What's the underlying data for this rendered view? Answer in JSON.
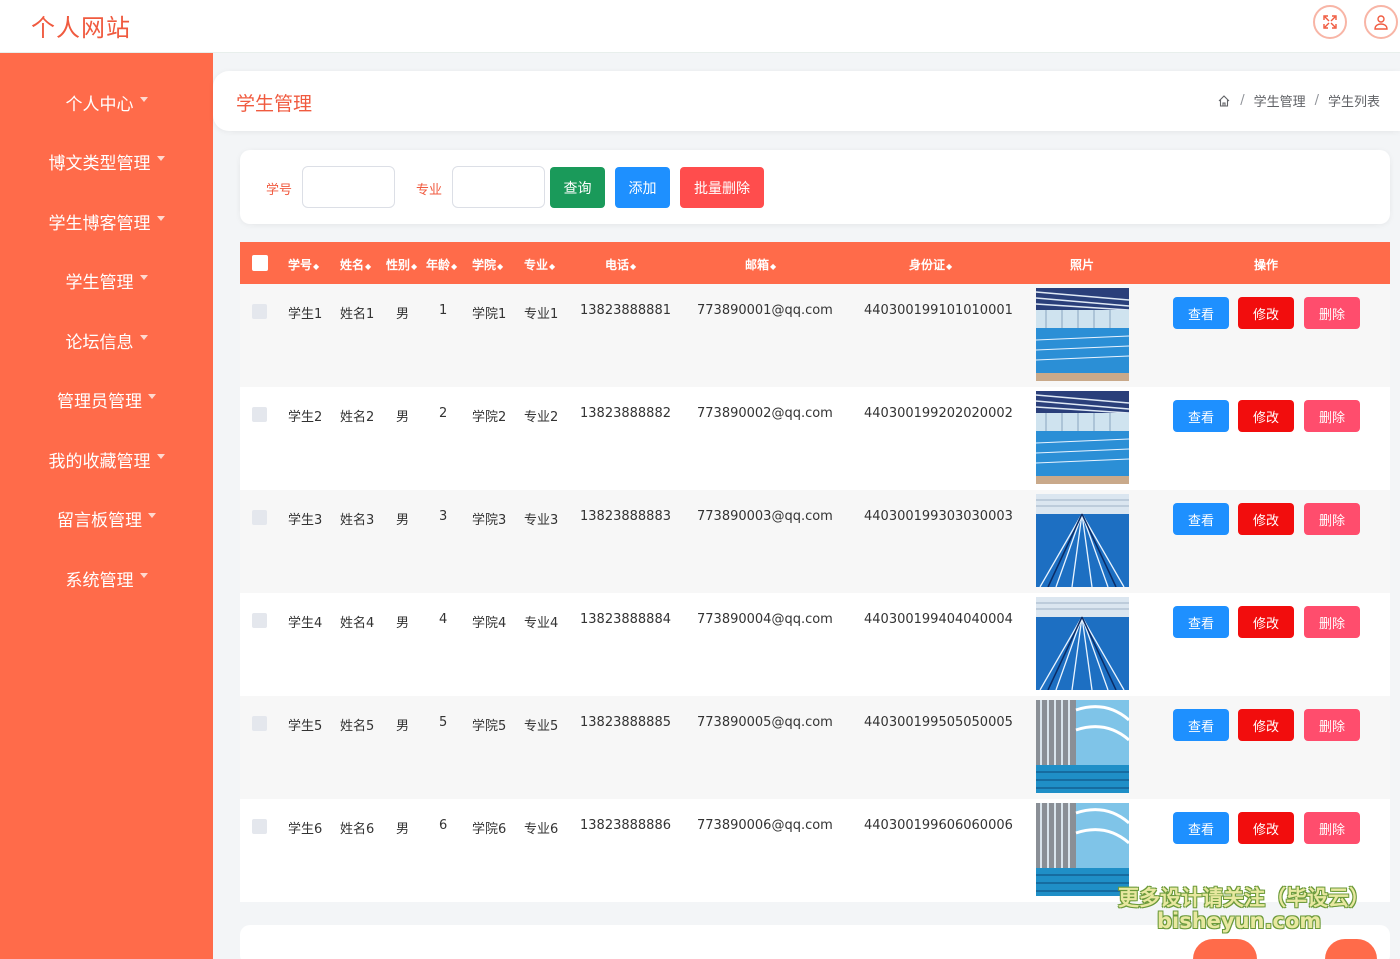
{
  "header": {
    "brand": "个人网站",
    "fullscreen_icon": "fullscreen-icon",
    "user_icon": "user-icon"
  },
  "sidebar": {
    "items": [
      {
        "label": "个人中心"
      },
      {
        "label": "博文类型管理"
      },
      {
        "label": "学生博客管理"
      },
      {
        "label": "学生管理"
      },
      {
        "label": "论坛信息"
      },
      {
        "label": "管理员管理"
      },
      {
        "label": "我的收藏管理"
      },
      {
        "label": "留言板管理"
      },
      {
        "label": "系统管理"
      }
    ]
  },
  "title_bar": {
    "title": "学生管理",
    "breadcrumb": [
      "学生管理",
      "学生列表"
    ],
    "sep": "/"
  },
  "search": {
    "student_no_label": "学号",
    "major_label": "专业",
    "query_label": "查询",
    "add_label": "添加",
    "batch_delete_label": "批量删除"
  },
  "table": {
    "columns": [
      "学号",
      "姓名",
      "性别",
      "年龄",
      "学院",
      "专业",
      "电话",
      "邮箱",
      "身份证",
      "照片",
      "操作"
    ],
    "sort_glyph": "◆",
    "rows": [
      {
        "no": "学生1",
        "name": "姓名1",
        "gender": "男",
        "age": "1",
        "college": "学院1",
        "major": "专业1",
        "phone": "13823888881",
        "email": "773890001@qq.com",
        "id_card": "440300199101010001"
      },
      {
        "no": "学生2",
        "name": "姓名2",
        "gender": "男",
        "age": "2",
        "college": "学院2",
        "major": "专业2",
        "phone": "13823888882",
        "email": "773890002@qq.com",
        "id_card": "440300199202020002"
      },
      {
        "no": "学生3",
        "name": "姓名3",
        "gender": "男",
        "age": "3",
        "college": "学院3",
        "major": "专业3",
        "phone": "13823888883",
        "email": "773890003@qq.com",
        "id_card": "440300199303030003"
      },
      {
        "no": "学生4",
        "name": "姓名4",
        "gender": "男",
        "age": "4",
        "college": "学院4",
        "major": "专业4",
        "phone": "13823888884",
        "email": "773890004@qq.com",
        "id_card": "440300199404040004"
      },
      {
        "no": "学生5",
        "name": "姓名5",
        "gender": "男",
        "age": "5",
        "college": "学院5",
        "major": "专业5",
        "phone": "13823888885",
        "email": "773890005@qq.com",
        "id_card": "440300199505050005"
      },
      {
        "no": "学生6",
        "name": "姓名6",
        "gender": "男",
        "age": "6",
        "college": "学院6",
        "major": "专业6",
        "phone": "13823888886",
        "email": "773890006@qq.com",
        "id_card": "440300199606060006"
      }
    ],
    "actions": {
      "view": "查看",
      "edit": "修改",
      "delete": "删除"
    }
  },
  "watermark": {
    "line1": "更多设计请关注（毕设云）",
    "line2": "bisheyun.com"
  },
  "colors": {
    "accent": "#ff6b4a",
    "title": "#f05a3f",
    "query": "#1a9a5a",
    "view": "#1e90ff",
    "edit": "#f20d0d",
    "delete": "#ff4d6d"
  }
}
